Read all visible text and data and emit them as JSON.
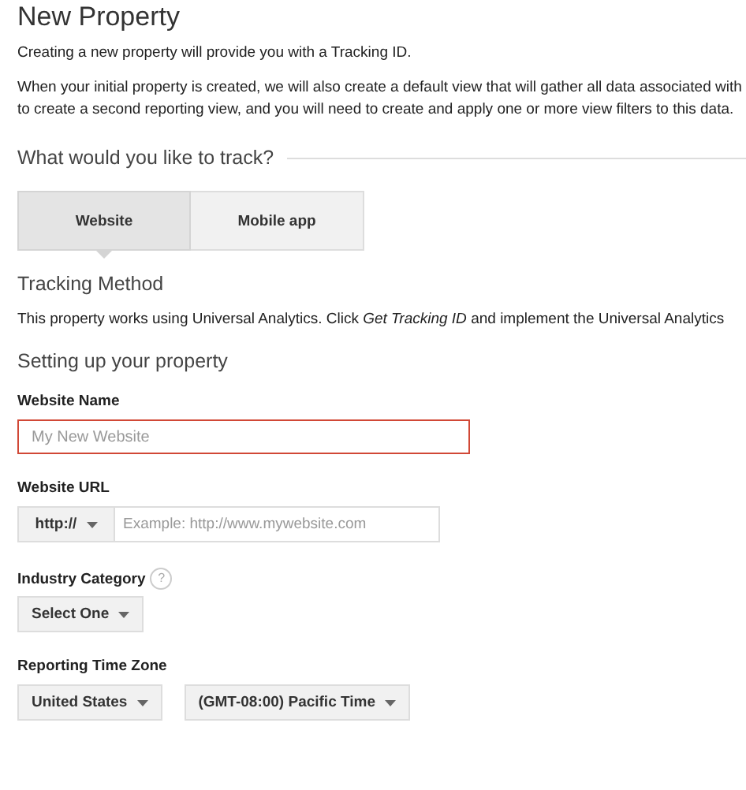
{
  "title": "New Property",
  "intro": [
    "Creating a new property will provide you with a Tracking ID.",
    "When your initial property is created, we will also create a default view that will gather all data associated with",
    "to create a second reporting view, and you will need to create and apply one or more view filters to this data."
  ],
  "track_heading": "What would you like to track?",
  "tabs": [
    {
      "label": "Website",
      "selected": true
    },
    {
      "label": "Mobile app",
      "selected": false
    }
  ],
  "tracking_method": {
    "heading": "Tracking Method",
    "text": "This property works using Universal Analytics. Click *Get Tracking ID* and implement the Universal Analytics"
  },
  "setup_heading": "Setting up your property",
  "website_name": {
    "label": "Website Name",
    "placeholder": "My New Website",
    "invalid": true
  },
  "website_url": {
    "label": "Website URL",
    "protocol": "http://",
    "placeholder": "Example: http://www.mywebsite.com"
  },
  "industry_category": {
    "label": "Industry Category",
    "help": "?",
    "value": "Select One"
  },
  "time_zone": {
    "label": "Reporting Time Zone",
    "country": "United States",
    "zone": "(GMT-08:00) Pacific Time"
  }
}
